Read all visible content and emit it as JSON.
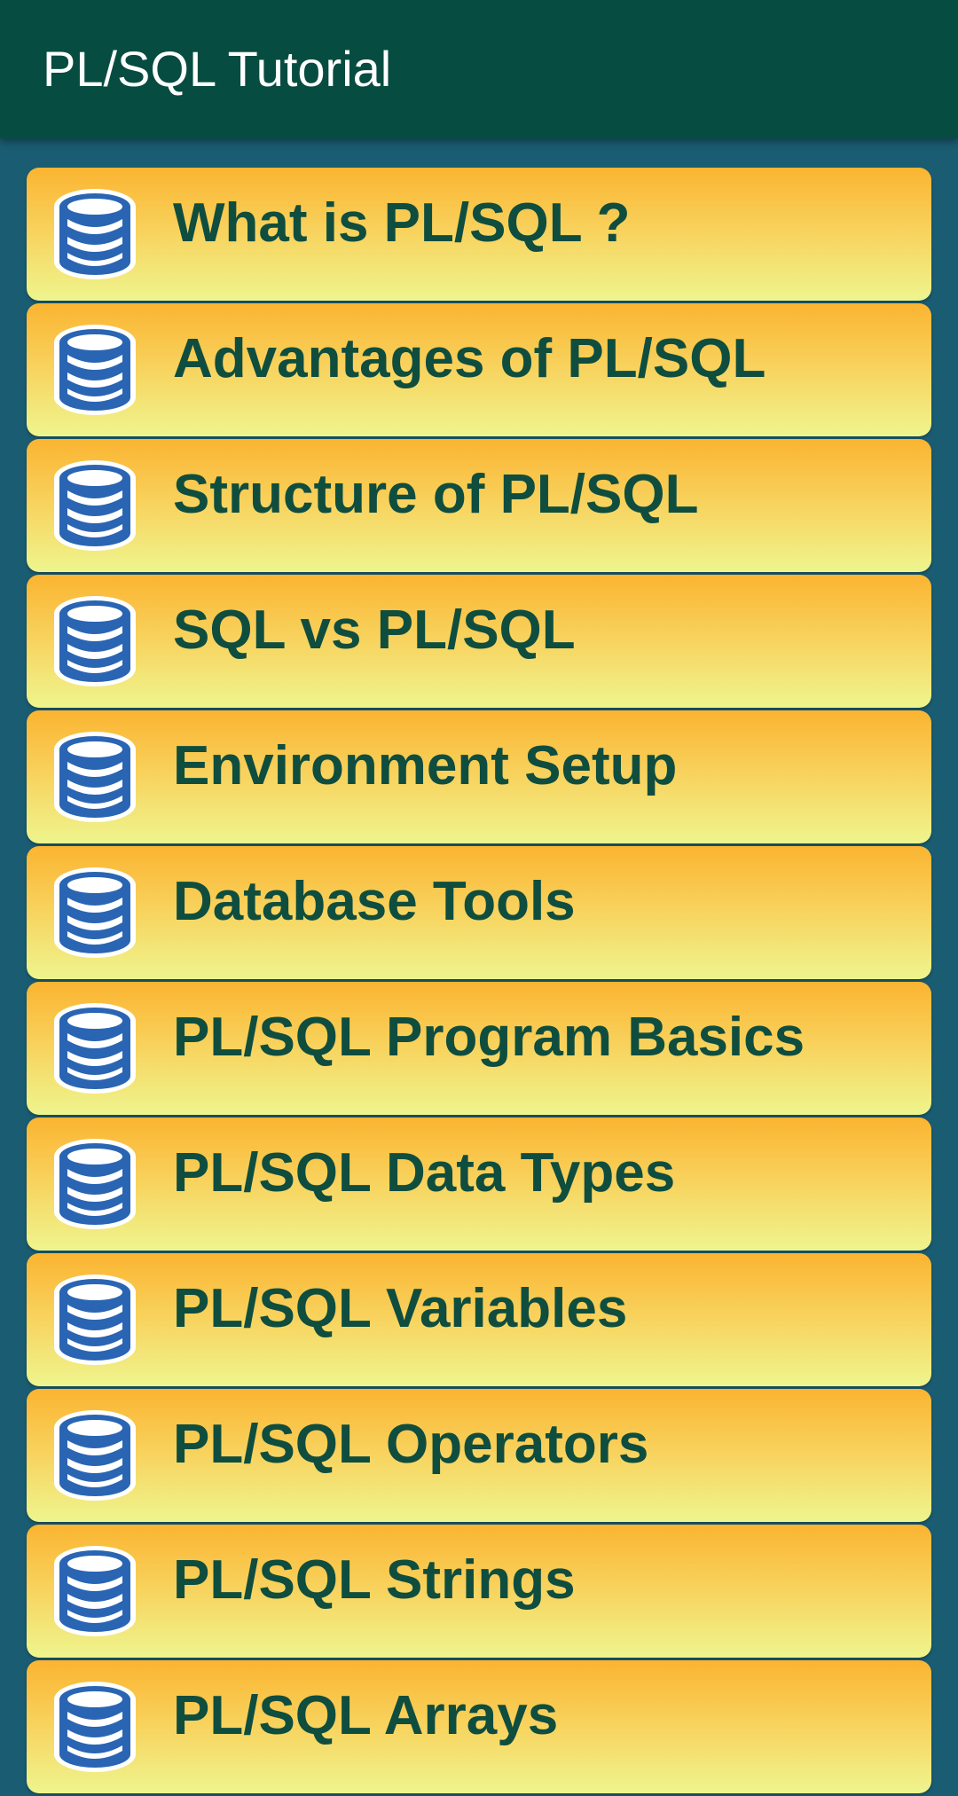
{
  "app_bar": {
    "title": "PL/SQL Tutorial"
  },
  "icon": "database-icon",
  "colors": {
    "app_bar": "#074c40",
    "background": "#1a5c72",
    "card_top": "#fbb431",
    "card_bottom": "#eef58e",
    "label": "#0f4d3f",
    "icon_blue": "#2a65b3"
  },
  "topics": [
    {
      "label": "What is PL/SQL ?"
    },
    {
      "label": "Advantages of PL/SQL"
    },
    {
      "label": "Structure of PL/SQL"
    },
    {
      "label": "SQL vs PL/SQL"
    },
    {
      "label": "Environment Setup"
    },
    {
      "label": "Database Tools"
    },
    {
      "label": "PL/SQL Program Basics"
    },
    {
      "label": "PL/SQL Data Types"
    },
    {
      "label": "PL/SQL Variables"
    },
    {
      "label": "PL/SQL Operators"
    },
    {
      "label": "PL/SQL Strings"
    },
    {
      "label": "PL/SQL Arrays"
    }
  ]
}
